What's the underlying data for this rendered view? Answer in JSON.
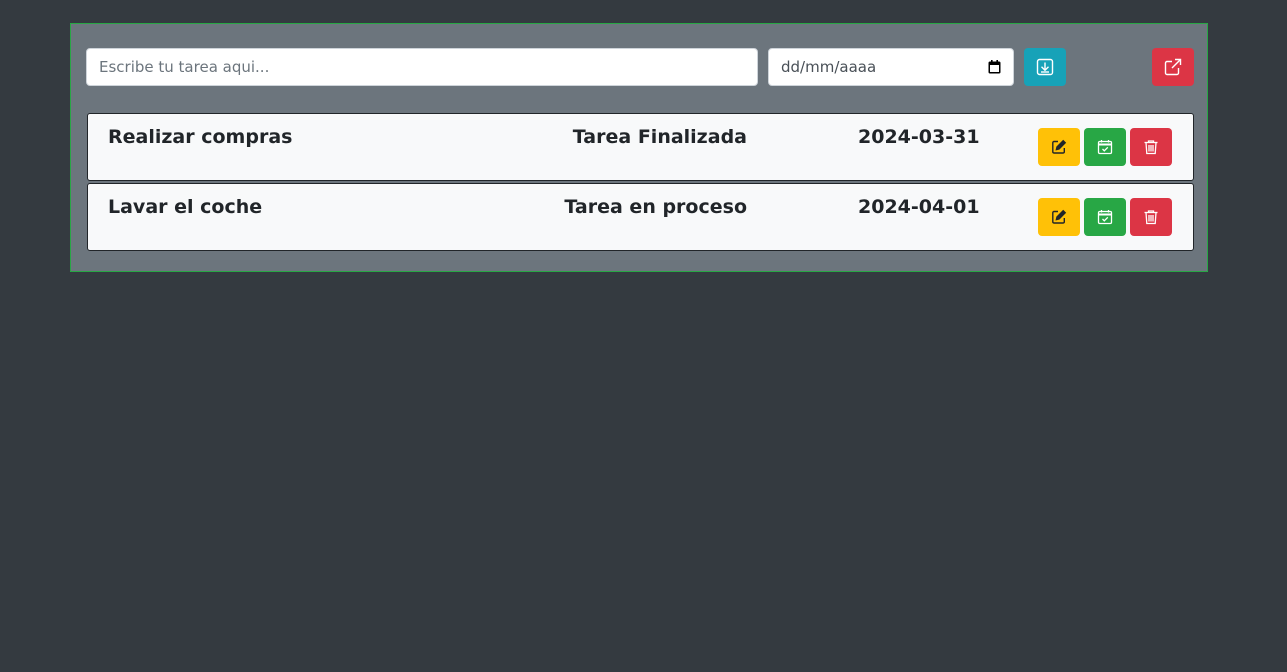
{
  "form": {
    "task_placeholder": "Escribe tu tarea aqui...",
    "task_value": "",
    "date_placeholder": "dd/mm/aaaa",
    "save_icon": "download-box-icon",
    "exit_icon": "external-link-icon"
  },
  "tasks": [
    {
      "name": "Realizar compras",
      "status": "Tarea Finalizada",
      "date": "2024-03-31"
    },
    {
      "name": "Lavar el coche",
      "status": "Tarea en proceso",
      "date": "2024-04-01"
    }
  ],
  "row_actions": {
    "edit_icon": "edit-pencil-icon",
    "complete_icon": "calendar-check-icon",
    "delete_icon": "trash-icon"
  },
  "colors": {
    "background": "#343a40",
    "panel": "#6c757d",
    "panel_border": "#28a745",
    "save_button": "#17a2b8",
    "exit_button": "#dc3545",
    "edit_button": "#ffc107",
    "complete_button": "#28a745",
    "delete_button": "#dc3545"
  }
}
